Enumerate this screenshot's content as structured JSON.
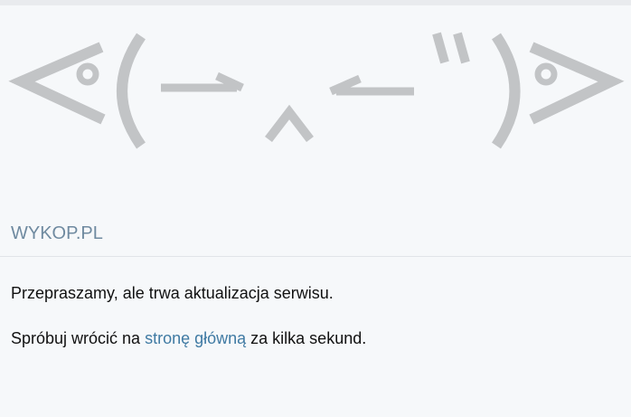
{
  "header": {
    "site_name": "WYKOP.PL"
  },
  "message": {
    "line1": "Przepraszamy, ale trwa aktualizacja serwisu.",
    "line2_before": "Spróbuj wrócić na ",
    "home_link": "stronę główną",
    "line2_after": " za kilka sekund."
  },
  "colors": {
    "background": "#f6f8fa",
    "kaomoji": "#c2c4c6",
    "site_name": "#6f8aa0",
    "link": "#3f7aa3"
  }
}
